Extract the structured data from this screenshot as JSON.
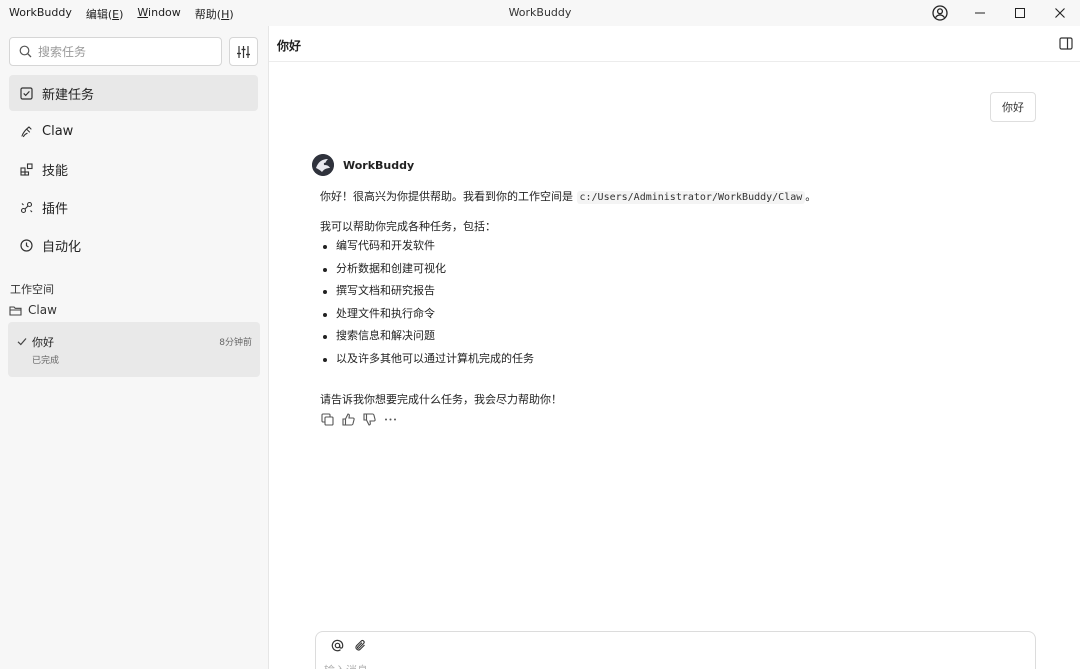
{
  "titlebar": {
    "app_name": "WorkBuddy",
    "window_title": "WorkBuddy",
    "menus": [
      {
        "label": "编辑(",
        "key": "E",
        "suffix": ")"
      },
      {
        "label": "",
        "key": "W",
        "suffix": "indow"
      },
      {
        "label": "帮助(",
        "key": "H",
        "suffix": ")"
      }
    ]
  },
  "sidebar": {
    "search_placeholder": "搜索任务",
    "nav": [
      {
        "label": "新建任务",
        "icon": "new-task-icon",
        "active": true
      },
      {
        "label": "Claw",
        "icon": "claw-icon",
        "active": false
      },
      {
        "label": "技能",
        "icon": "skills-icon",
        "active": false
      },
      {
        "label": "插件",
        "icon": "plugin-icon",
        "active": false
      },
      {
        "label": "自动化",
        "icon": "clock-icon",
        "active": false
      }
    ],
    "workspace_title": "工作空间",
    "workspace_folder": "Claw",
    "task": {
      "name": "你好",
      "time": "8分钟前",
      "status": "已完成"
    }
  },
  "main": {
    "title": "你好",
    "user_message": "你好",
    "bot_name": "WorkBuddy",
    "message": {
      "line1_prefix": "你好！很高兴为你提供帮助。我看到你的工作空间是 ",
      "line1_path": "c:/Users/Administrator/WorkBuddy/Claw",
      "line1_suffix": "。",
      "intro": "我可以帮助你完成各种任务，包括：",
      "items": [
        "编写代码和开发软件",
        "分析数据和创建可视化",
        "撰写文档和研究报告",
        "处理文件和执行命令",
        "搜索信息和解决问题",
        "以及许多其他可以通过计算机完成的任务"
      ],
      "closing": "请告诉我你想要完成什么任务，我会尽力帮助你！"
    },
    "composer_placeholder": "输入消息"
  }
}
